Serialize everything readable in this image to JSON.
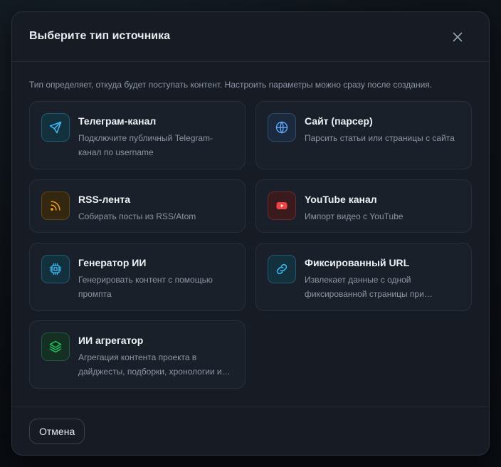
{
  "dialog": {
    "title": "Выберите тип источника",
    "description": "Тип определяет, откуда будет поступать контент. Настроить параметры можно сразу после создания.",
    "cancel_label": "Отмена"
  },
  "cards": [
    {
      "title": "Телеграм-канал",
      "description": "Подключите публичный Telegram-канал по username",
      "icon": "send-icon",
      "accent": "#38bdf8"
    },
    {
      "title": "Сайт (парсер)",
      "description": "Парсить статьи или страницы с сайта",
      "icon": "globe-icon",
      "accent": "#60a5fa"
    },
    {
      "title": "RSS-лента",
      "description": "Собирать посты из RSS/Atom",
      "icon": "rss-icon",
      "accent": "#f59e0b"
    },
    {
      "title": "YouTube канал",
      "description": "Импорт видео с YouTube",
      "icon": "youtube-icon",
      "accent": "#ef4444"
    },
    {
      "title": "Генератор ИИ",
      "description": "Генерировать контент с помощью промпта",
      "icon": "cpu-icon",
      "accent": "#38bdf8"
    },
    {
      "title": "Фиксированный URL",
      "description": "Извлекает данные с одной фиксированной страницы при создании источника",
      "icon": "link-icon",
      "accent": "#38bdf8"
    },
    {
      "title": "ИИ агрегатор",
      "description": "Агрегация контента проекта в дайджесты, подборки, хронологии и другие форматы",
      "icon": "layers-icon",
      "accent": "#22c55e"
    }
  ]
}
